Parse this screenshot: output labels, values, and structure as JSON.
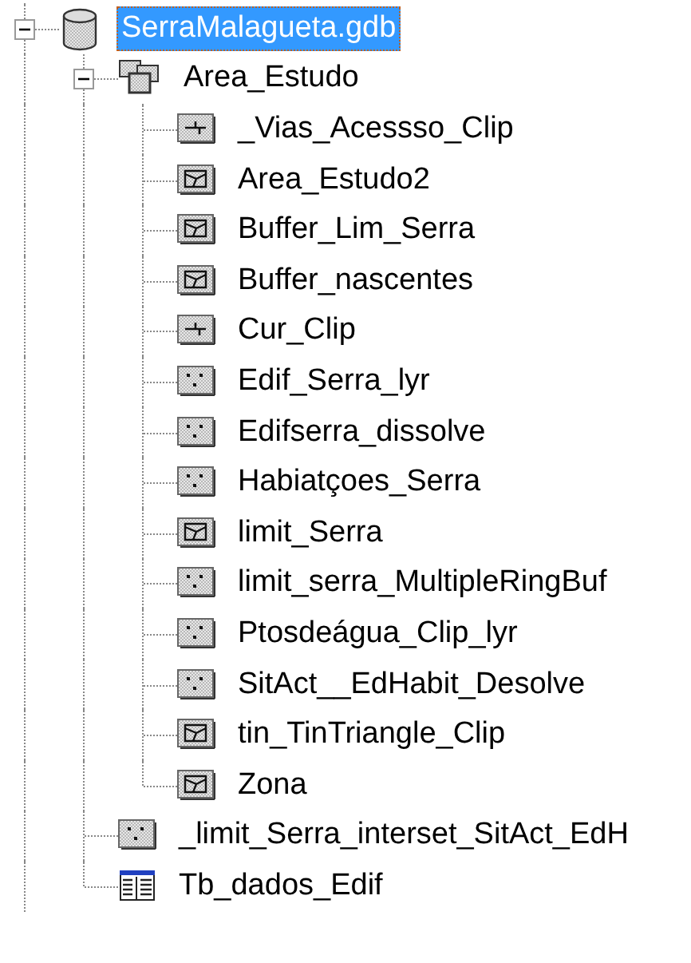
{
  "tree": [
    {
      "label": "SerraMalagueta.gdb",
      "kind": "geodatabase",
      "selected": true,
      "expanded": true,
      "children": [
        {
          "label": "Area_Estudo",
          "kind": "dataset",
          "selected": false,
          "expanded": true,
          "children": [
            {
              "label": "_Vias_Acessso_Clip",
              "kind": "line",
              "selected": false
            },
            {
              "label": "Area_Estudo2",
              "kind": "polygon",
              "selected": false
            },
            {
              "label": "Buffer_Lim_Serra",
              "kind": "polygon",
              "selected": false
            },
            {
              "label": "Buffer_nascentes",
              "kind": "polygon",
              "selected": false
            },
            {
              "label": "Cur_Clip",
              "kind": "line",
              "selected": false
            },
            {
              "label": "Edif_Serra_lyr",
              "kind": "point",
              "selected": false
            },
            {
              "label": "Edifserra_dissolve",
              "kind": "point",
              "selected": false
            },
            {
              "label": "Habiatçoes_Serra",
              "kind": "point",
              "selected": false
            },
            {
              "label": "limit_Serra",
              "kind": "polygon",
              "selected": false
            },
            {
              "label": "limit_serra_MultipleRingBuf",
              "kind": "point",
              "selected": false
            },
            {
              "label": "Ptosdeágua_Clip_lyr",
              "kind": "point",
              "selected": false
            },
            {
              "label": "SitAct__EdHabit_Desolve",
              "kind": "point",
              "selected": false
            },
            {
              "label": "tin_TinTriangle_Clip",
              "kind": "polygon",
              "selected": false
            },
            {
              "label": "Zona",
              "kind": "polygon",
              "selected": false
            }
          ]
        },
        {
          "label": "_limit_Serra_interset_SitAct_EdH",
          "kind": "point",
          "selected": false
        },
        {
          "label": "Tb_dados_Edif",
          "kind": "table",
          "selected": false
        }
      ]
    }
  ]
}
